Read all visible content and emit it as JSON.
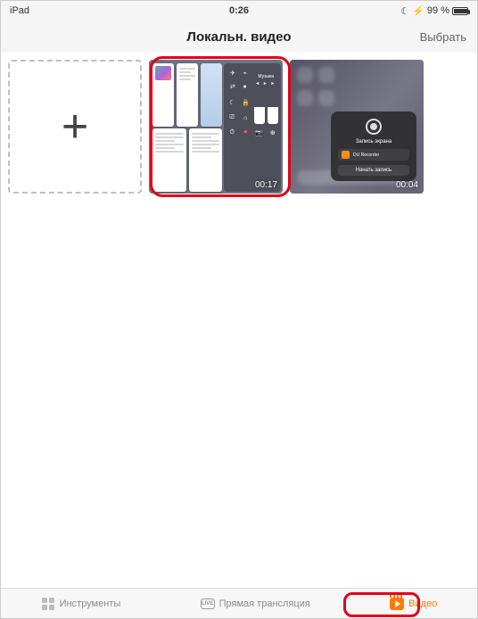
{
  "status": {
    "device": "iPad",
    "time": "0:26",
    "battery_pct": "99 %",
    "do_not_disturb_icon": "☾",
    "charging_icon": "⚡"
  },
  "nav": {
    "title": "Локальн. видео",
    "select": "Выбрать"
  },
  "videos": [
    {
      "duration": "00:17"
    },
    {
      "duration": "00:04"
    }
  ],
  "video2_sheet": {
    "title": "Запись экрана",
    "app": "DU Recorder",
    "button": "Начать запись"
  },
  "tabs": {
    "tools": "Инструменты",
    "live_badge": "LIVE",
    "live": "Прямая трансляция",
    "video": "Видео"
  },
  "cc": {
    "music_label": "Музыка"
  }
}
